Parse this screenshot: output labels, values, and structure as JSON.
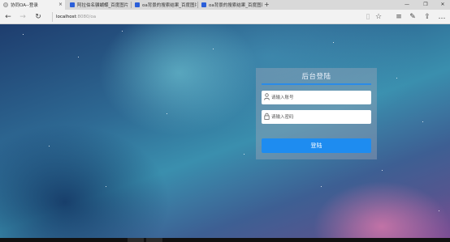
{
  "tabs": [
    {
      "title": "协同OA--登录",
      "icon": "globe-icon",
      "active": true,
      "close": "×"
    },
    {
      "title": "阿拉伯名骥蝴蝶_百度图片",
      "icon": "baidu-paw-icon",
      "active": false
    },
    {
      "title": "oa背景的搜索结果_百度图片",
      "icon": "baidu-paw-icon",
      "active": false
    },
    {
      "title": "oa背景的搜索结果_百度图片",
      "icon": "baidu-paw-icon",
      "active": false
    }
  ],
  "new_tab_label": "+",
  "window_controls": {
    "minimize": "—",
    "restore": "❐",
    "close": "✕"
  },
  "toolbar": {
    "back": "←",
    "forward": "→",
    "refresh": "↻",
    "address_host": "localhost",
    "address_rest": ":8080/oa",
    "reading_view": "▯",
    "favorite": "☆",
    "hub": "≡",
    "notes": "✎",
    "share": "⇪",
    "more": "…"
  },
  "login": {
    "title": "后台登陆",
    "username_placeholder": "请输入账号",
    "password_placeholder": "请输入密码",
    "username_icon": "user-icon",
    "password_icon": "lock-icon",
    "submit_label": "登陆"
  },
  "colors": {
    "accent": "#1e8cf0",
    "card_rule": "#2a8be8"
  }
}
